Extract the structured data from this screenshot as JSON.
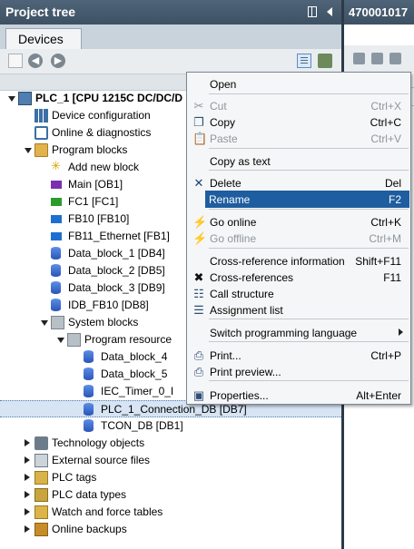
{
  "panel": {
    "title": "Project tree"
  },
  "right_panel": {
    "title": "470001017"
  },
  "tabs": {
    "devices": "Devices"
  },
  "tree": [
    {
      "label": "PLC_1 [CPU 1215C DC/DC/D",
      "icon": "plc-icon",
      "expander": "expanded",
      "bold": true
    },
    {
      "label": "Device configuration",
      "icon": "device-config-icon",
      "expander": "none"
    },
    {
      "label": "Online & diagnostics",
      "icon": "diagnostics-icon",
      "expander": "none"
    },
    {
      "label": "Program blocks",
      "icon": "folder-icon",
      "expander": "expanded"
    },
    {
      "label": "Add new block",
      "icon": "add-block-icon",
      "expander": "none"
    },
    {
      "label": "Main [OB1]",
      "icon": "ob-block-icon",
      "expander": "none"
    },
    {
      "label": "FC1 [FC1]",
      "icon": "fc-block-icon",
      "expander": "none"
    },
    {
      "label": "FB10 [FB10]",
      "icon": "fb-block-icon",
      "expander": "none"
    },
    {
      "label": "FB11_Ethernet [FB1]",
      "icon": "fb-block-icon",
      "expander": "none"
    },
    {
      "label": "Data_block_1 [DB4]",
      "icon": "db-icon",
      "expander": "none"
    },
    {
      "label": "Data_block_2 [DB5]",
      "icon": "db-icon",
      "expander": "none"
    },
    {
      "label": "Data_block_3 [DB9]",
      "icon": "db-icon",
      "expander": "none"
    },
    {
      "label": "IDB_FB10 [DB8]",
      "icon": "db-icon",
      "expander": "none"
    },
    {
      "label": "System blocks",
      "icon": "system-folder-icon",
      "expander": "expanded"
    },
    {
      "label": "Program resource",
      "icon": "system-folder-icon",
      "expander": "expanded"
    },
    {
      "label": "Data_block_4",
      "icon": "db-icon",
      "expander": "none"
    },
    {
      "label": "Data_block_5",
      "icon": "db-icon",
      "expander": "none"
    },
    {
      "label": "IEC_Timer_0_I",
      "icon": "db-icon",
      "expander": "none"
    },
    {
      "label": "PLC_1_Connection_DB [DB7]",
      "icon": "db-icon",
      "expander": "none",
      "selected": true
    },
    {
      "label": "TCON_DB [DB1]",
      "icon": "db-icon",
      "expander": "none"
    },
    {
      "label": "Technology objects",
      "icon": "technology-icon",
      "expander": "collapsed"
    },
    {
      "label": "External source files",
      "icon": "external-files-icon",
      "expander": "collapsed"
    },
    {
      "label": "PLC tags",
      "icon": "plc-tags-icon",
      "expander": "collapsed"
    },
    {
      "label": "PLC data types",
      "icon": "plc-data-types-icon",
      "expander": "collapsed"
    },
    {
      "label": "Watch and force tables",
      "icon": "watch-tables-icon",
      "expander": "collapsed"
    },
    {
      "label": "Online backups",
      "icon": "backup-icon",
      "expander": "collapsed"
    }
  ],
  "context_menu": [
    {
      "label": "Open",
      "shortcut": ""
    },
    {
      "label": "Cut",
      "shortcut": "Ctrl+X",
      "icon": "scissors-icon",
      "disabled": true
    },
    {
      "label": "Copy",
      "shortcut": "Ctrl+C",
      "icon": "copy-icon"
    },
    {
      "label": "Paste",
      "shortcut": "Ctrl+V",
      "icon": "paste-icon",
      "disabled": true
    },
    {
      "label": "Copy as text",
      "shortcut": ""
    },
    {
      "label": "Delete",
      "shortcut": "Del",
      "icon": "delete-x-icon"
    },
    {
      "label": "Rename",
      "shortcut": "F2",
      "highlighted": true
    },
    {
      "label": "Go online",
      "shortcut": "Ctrl+K",
      "icon": "go-online-icon"
    },
    {
      "label": "Go offline",
      "shortcut": "Ctrl+M",
      "icon": "go-offline-icon",
      "disabled": true
    },
    {
      "label": "Cross-reference information",
      "shortcut": "Shift+F11"
    },
    {
      "label": "Cross-references",
      "shortcut": "F11",
      "icon": "cross-references-icon"
    },
    {
      "label": "Call structure",
      "shortcut": "",
      "icon": "call-structure-icon"
    },
    {
      "label": "Assignment list",
      "shortcut": "",
      "icon": "assignment-list-icon"
    },
    {
      "label": "Switch programming language",
      "shortcut": "",
      "submenu": true
    },
    {
      "label": "Print...",
      "shortcut": "Ctrl+P",
      "icon": "print-icon"
    },
    {
      "label": "Print preview...",
      "shortcut": "",
      "icon": "print-preview-icon"
    },
    {
      "label": "Properties...",
      "shortcut": "Alt+Enter",
      "icon": "properties-icon"
    }
  ],
  "colors": {
    "title_bar": "#45596c",
    "menu_highlight": "#1e5d9f",
    "selection": "#d6e4f3"
  }
}
